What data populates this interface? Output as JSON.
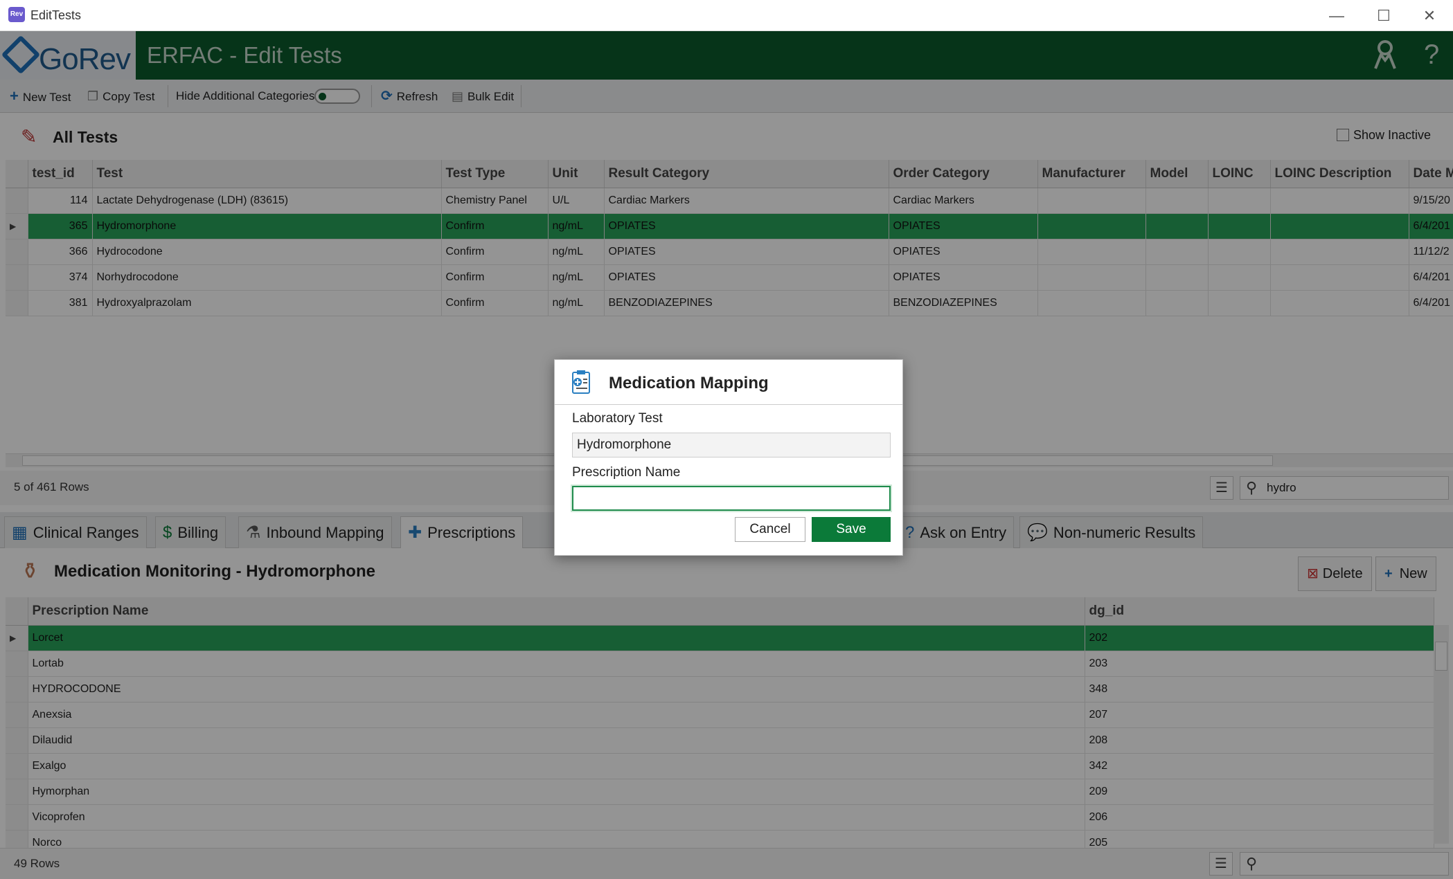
{
  "window": {
    "title": "EditTests",
    "minimize": "—",
    "maximize": "☐",
    "close": "✕"
  },
  "header": {
    "logo_text": "GoRev",
    "title": "ERFAC - Edit Tests",
    "help": "?"
  },
  "toolbar": {
    "new_test": "New Test",
    "copy_test": "Copy Test",
    "hide_additional": "Hide Additional Categories",
    "refresh": "Refresh",
    "bulk_edit": "Bulk Edit"
  },
  "tests": {
    "title": "All Tests",
    "show_inactive": "Show Inactive",
    "columns": [
      "test_id",
      "Test",
      "Test Type",
      "Unit",
      "Result Category",
      "Order Category",
      "Manufacturer",
      "Model",
      "LOINC",
      "LOINC Description",
      "Date M"
    ],
    "rows": [
      [
        "114",
        "Lactate Dehydrogenase (LDH) (83615)",
        "Chemistry Panel",
        "U/L",
        "Cardiac Markers",
        "Cardiac Markers",
        "",
        "",
        "",
        "",
        "9/15/20"
      ],
      [
        "365",
        "Hydromorphone",
        "Confirm",
        "ng/mL",
        "OPIATES",
        "OPIATES",
        "",
        "",
        "",
        "",
        "6/4/201"
      ],
      [
        "366",
        "Hydrocodone",
        "Confirm",
        "ng/mL",
        "OPIATES",
        "OPIATES",
        "",
        "",
        "",
        "",
        "11/12/2"
      ],
      [
        "374",
        "Norhydrocodone",
        "Confirm",
        "ng/mL",
        "OPIATES",
        "OPIATES",
        "",
        "",
        "",
        "",
        "6/4/201"
      ],
      [
        "381",
        "Hydroxyalprazolam",
        "Confirm",
        "ng/mL",
        "BENZODIAZEPINES",
        "BENZODIAZEPINES",
        "",
        "",
        "",
        "",
        "6/4/201"
      ]
    ],
    "selected_row": 1,
    "row_count": "5 of 461 Rows",
    "search_value": "hydro"
  },
  "tabs": [
    "Clinical Ranges",
    "Billing",
    "Inbound Mapping",
    "Prescriptions",
    "Ask on Entry",
    "Non-numeric Results"
  ],
  "active_tab": "Prescriptions",
  "medication": {
    "title": "Medication Monitoring - Hydromorphone",
    "delete": "Delete",
    "new": "New",
    "columns": [
      "Prescription Name",
      "dg_id"
    ],
    "rows": [
      [
        "Lorcet",
        "202"
      ],
      [
        "Lortab",
        "203"
      ],
      [
        "HYDROCODONE",
        "348"
      ],
      [
        "Anexsia",
        "207"
      ],
      [
        "Dilaudid",
        "208"
      ],
      [
        "Exalgo",
        "342"
      ],
      [
        "Hymorphan",
        "209"
      ],
      [
        "Vicoprofen",
        "206"
      ],
      [
        "Norco",
        "205"
      ]
    ],
    "row_count": "49 Rows",
    "search_value": ""
  },
  "dialog": {
    "title": "Medication Mapping",
    "lab_test_label": "Laboratory Test",
    "lab_test_value": "Hydromorphone",
    "prescription_label": "Prescription Name",
    "prescription_value": "",
    "cancel": "Cancel",
    "save": "Save"
  }
}
